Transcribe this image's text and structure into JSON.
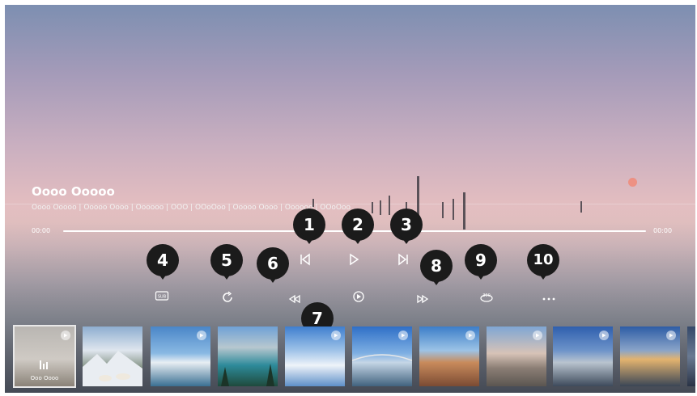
{
  "video": {
    "title": "Oooo Ooooo",
    "meta": "Oooo Ooooo | Ooooo Oooo | Oooooo | OOO | OOoOoo | Ooooo Oooo | Oooooo | OOoOoo"
  },
  "progress": {
    "elapsed": "00:00",
    "total": "00:00",
    "fraction": 0.0
  },
  "controls": [
    {
      "id": "prev",
      "icon": "skip-previous-icon",
      "callout": "1"
    },
    {
      "id": "play",
      "icon": "play-icon",
      "callout": "2"
    },
    {
      "id": "next",
      "icon": "skip-next-icon",
      "callout": "3"
    },
    {
      "id": "subtitle",
      "icon": "subtitle-icon",
      "callout": "4"
    },
    {
      "id": "repeat",
      "icon": "repeat-icon",
      "callout": "5"
    },
    {
      "id": "rewind",
      "icon": "rewind-icon",
      "callout": "6"
    },
    {
      "id": "auto",
      "icon": "auto-play-icon",
      "callout": "7"
    },
    {
      "id": "fast-forward",
      "icon": "fast-forward-icon",
      "callout": "8"
    },
    {
      "id": "view360",
      "icon": "360-view-icon",
      "callout": "9"
    },
    {
      "id": "more",
      "icon": "more-options-icon",
      "callout": "10"
    }
  ],
  "subtitle_icon_label": "SUB",
  "view360_icon_label": "360",
  "playlist": {
    "selected_label": "Ooo Oooo",
    "items": [
      {
        "scene": "sunset-reeds",
        "selected": true
      },
      {
        "scene": "mountain-goats"
      },
      {
        "scene": "glacier-lake"
      },
      {
        "scene": "mountain-lake-pines"
      },
      {
        "scene": "clouds-sky"
      },
      {
        "scene": "bridge-river"
      },
      {
        "scene": "canyon"
      },
      {
        "scene": "winter-trees"
      },
      {
        "scene": "harbor-boats"
      },
      {
        "scene": "sunset-coast"
      }
    ]
  }
}
